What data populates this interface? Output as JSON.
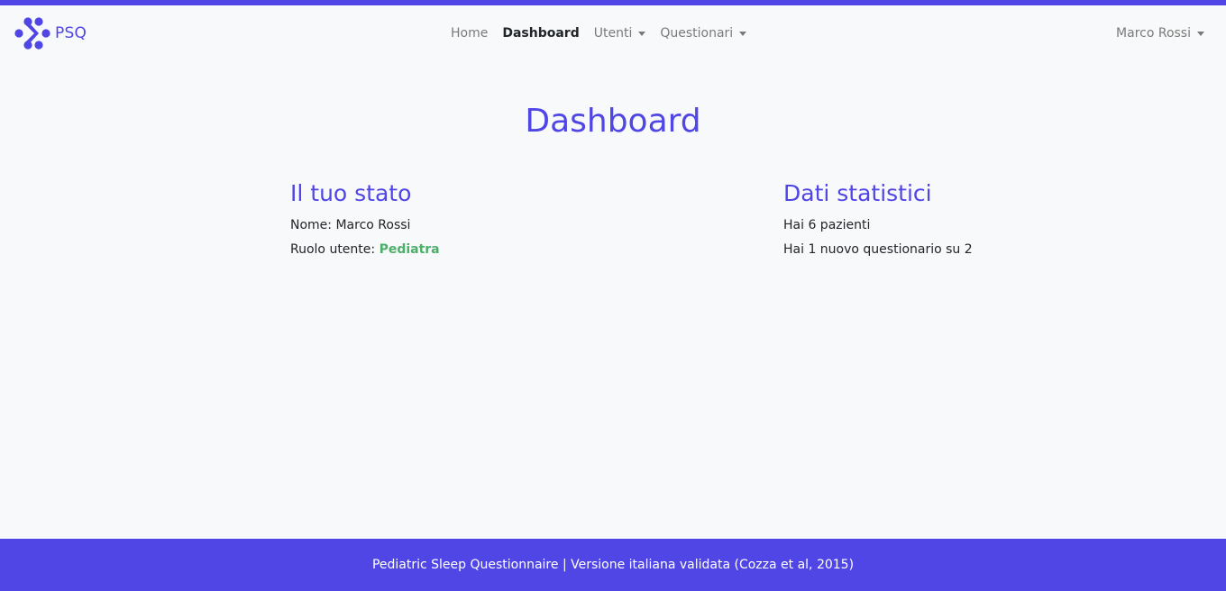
{
  "colors": {
    "accent": "#4f46e5",
    "role_color": "#4caf6a",
    "background": "#f8f9fa"
  },
  "navbar": {
    "brand_icon": "psq-logo-icon",
    "brand_text": "PSQ",
    "items": [
      {
        "label": "Home",
        "active": false,
        "dropdown": false
      },
      {
        "label": "Dashboard",
        "active": true,
        "dropdown": false
      },
      {
        "label": "Utenti",
        "active": false,
        "dropdown": true
      },
      {
        "label": "Questionari",
        "active": false,
        "dropdown": true
      }
    ],
    "user_menu": {
      "label": "Marco Rossi",
      "dropdown": true
    }
  },
  "main": {
    "title": "Dashboard",
    "status": {
      "title": "Il tuo stato",
      "name_label": "Nome: ",
      "name_value": "Marco Rossi",
      "role_label": "Ruolo utente: ",
      "role_value": "Pediatra"
    },
    "stats": {
      "title": "Dati statistici",
      "patients_text": "Hai 6 pazienti",
      "questionnaires_text": "Hai 1 nuovo questionario su 2"
    }
  },
  "footer": {
    "text": "Pediatric Sleep Questionnaire | Versione italiana validata (Cozza et al, 2015)"
  }
}
